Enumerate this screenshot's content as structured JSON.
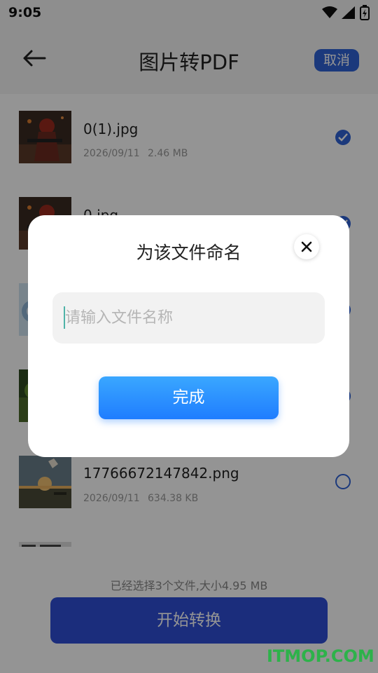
{
  "status_bar": {
    "time": "9:05",
    "icons": [
      "wifi-icon",
      "signal-icon",
      "battery-charging-icon"
    ]
  },
  "header": {
    "title": "图片转PDF",
    "cancel_label": "取消"
  },
  "files": [
    {
      "name": "0(1).jpg",
      "date": "2026/09/11",
      "size": "2.46 MB",
      "selected": true
    },
    {
      "name": "0.jpg",
      "date": "",
      "size": "",
      "selected": true
    },
    {
      "name": "",
      "date": "",
      "size": "",
      "selected": true
    },
    {
      "name": "",
      "date": "",
      "size": "",
      "selected": false
    },
    {
      "name": "17766672147842.png",
      "date": "2026/09/11",
      "size": "634.38 KB",
      "selected": false
    }
  ],
  "bottom": {
    "summary": "已经选择3个文件,大小4.95 MB",
    "start_label": "开始转换"
  },
  "dialog": {
    "title": "为该文件命名",
    "input_placeholder": "请输入文件名称",
    "input_value": "",
    "done_label": "完成"
  },
  "watermark": "ITMOP.COM",
  "colors": {
    "accent": "#2f63d6",
    "done_gradient_top": "#3aa7ff",
    "done_gradient_bottom": "#1f7dff",
    "watermark": "#2db24a"
  }
}
